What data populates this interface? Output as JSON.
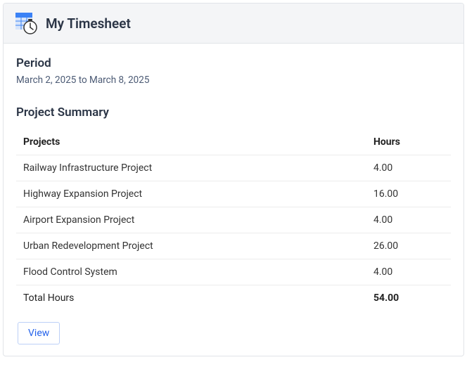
{
  "header": {
    "title": "My Timesheet"
  },
  "period": {
    "label": "Period",
    "value": "March 2, 2025 to March 8, 2025"
  },
  "summary": {
    "title": "Project Summary",
    "columns": {
      "projects": "Projects",
      "hours": "Hours"
    },
    "rows": [
      {
        "name": "Railway Infrastructure Project",
        "hours": "4.00"
      },
      {
        "name": "Highway Expansion Project",
        "hours": "16.00"
      },
      {
        "name": "Airport Expansion Project",
        "hours": "4.00"
      },
      {
        "name": "Urban Redevelopment Project",
        "hours": "26.00"
      },
      {
        "name": "Flood Control System",
        "hours": "4.00"
      }
    ],
    "total": {
      "label": "Total Hours",
      "value": "54.00"
    }
  },
  "actions": {
    "view": "View"
  }
}
